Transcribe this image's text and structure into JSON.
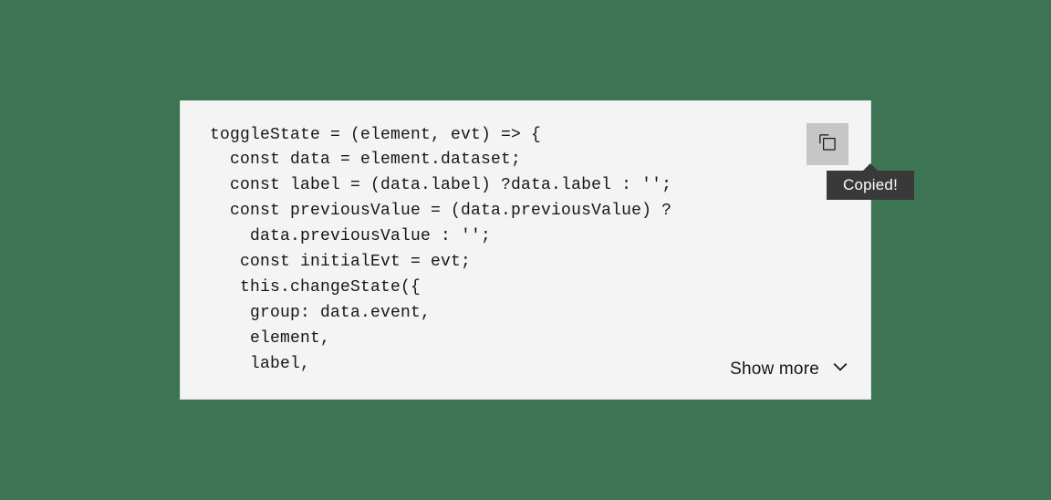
{
  "snippet": {
    "code_text": "toggleState = (element, evt) => {\n  const data = element.dataset;\n  const label = (data.label) ?data.label : '';\n  const previousValue = (data.previousValue) ?\n    data.previousValue : '';\n   const initialEvt = evt;\n   this.changeState({\n    group: data.event,\n    element,\n    label,",
    "show_more_label": "Show more",
    "tooltip_text": "Copied!"
  }
}
